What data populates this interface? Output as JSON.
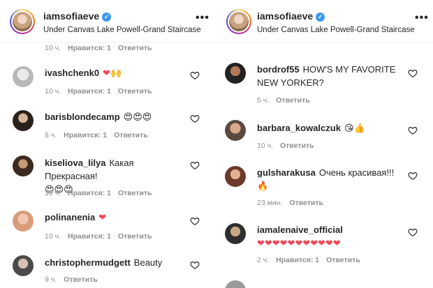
{
  "left": {
    "header": {
      "username": "iamsofiaeve",
      "location": "Under Canvas Lake Powell-Grand Staircase",
      "more_label": "•••"
    },
    "top_meta": {
      "time": "10 ч.",
      "likes": "Нравится: 1",
      "reply": "Ответить"
    },
    "comments": [
      {
        "user": "ivashchenk0",
        "text": "",
        "emoji": "❤🙌",
        "time": "10 ч.",
        "likes": "Нравится: 1",
        "reply": "Ответить"
      },
      {
        "user": "barisblondecamp",
        "text": "",
        "emoji": "😍😍😍",
        "time": "8 ч.",
        "likes": "Нравится: 1",
        "reply": "Ответить"
      },
      {
        "user": "kiseliova_lilya",
        "text": "Какая Прекрасная!",
        "emoji": "😍😍😍",
        "time": "10 ч.",
        "likes": "Нравится: 1",
        "reply": "Ответить"
      },
      {
        "user": "polinanenia",
        "text": "",
        "emoji": "❤",
        "time": "10 ч.",
        "likes": "Нравится: 1",
        "reply": "Ответить"
      },
      {
        "user": "christophermudgett",
        "text": "Beauty",
        "emoji": "",
        "time": "9 ч.",
        "likes": "",
        "reply": "Ответить"
      }
    ]
  },
  "right": {
    "header": {
      "username": "iamsofiaeve",
      "location": "Under Canvas Lake Powell-Grand Staircase",
      "more_label": "•••"
    },
    "comments": [
      {
        "user": "bordrof55",
        "text": "HOW'S MY FAVORITE NEW YORKER?",
        "emoji": "",
        "time": "5 ч.",
        "likes": "",
        "reply": "Ответить"
      },
      {
        "user": "barbara_kowalczuk",
        "text": "",
        "emoji": "😘👍",
        "time": "10 ч.",
        "likes": "",
        "reply": "Ответить"
      },
      {
        "user": "gulsharakusa",
        "text": "Очень красивая!!!",
        "emoji": "🔥",
        "time": "23 мин.",
        "likes": "",
        "reply": "Ответить"
      },
      {
        "user": "iamalenaive_official",
        "text": "",
        "emoji": "❤❤❤❤❤❤❤❤❤❤❤",
        "time": "2 ч.",
        "likes": "Нравится: 1",
        "reply": "Ответить"
      }
    ]
  },
  "colors": {
    "verified": "#3897f0",
    "heart": "#ed4956",
    "meta": "#8e8e8e"
  }
}
